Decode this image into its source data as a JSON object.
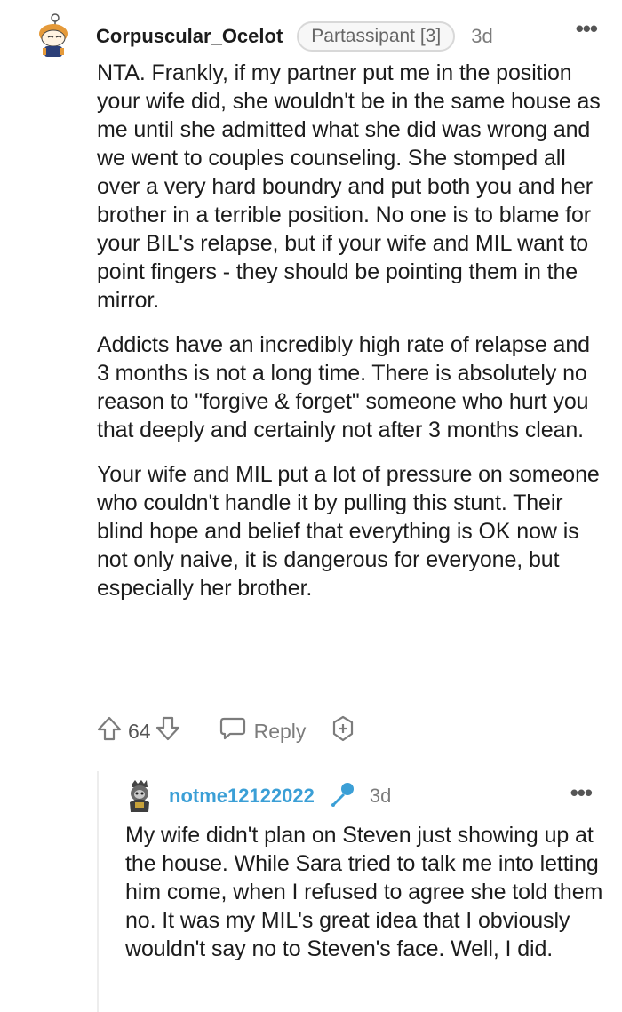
{
  "comment1": {
    "username": "Corpuscular_Ocelot",
    "flair": "Partassipant [3]",
    "age": "3d",
    "more": "•••",
    "paragraphs": [
      "NTA. Frankly, if my partner put me in the position your wife did, she wouldn't be in the same house as me until she admitted what she did was wrong and we went to couples counseling. She stomped all over a very hard boundry and put both you and her brother in a terrible position. No one is to blame for your BIL's relapse, but if your wife and MIL want to point fingers - they should be pointing them in the mirror.",
      "Addicts have an incredibly high rate of relapse and 3 months is not a long time. There is absolutely no reason to \"forgive & forget\" someone who hurt you that deeply and certainly not after 3 months clean.",
      "Your wife and MIL put a lot of pressure on someone who couldn't handle it by pulling this stunt. Their blind hope and belief that everything is OK now is not only naive, it is dangerous for everyone, but especially her brother."
    ],
    "score": "64",
    "reply_label": "Reply"
  },
  "comment2": {
    "username": "notme12122022",
    "age": "3d",
    "more": "•••",
    "paragraphs": [
      "My wife didn't plan on Steven just showing up at the house. While Sara tried to talk me into letting him come, when I refused to agree she told them no. It was my MIL's great idea that I obviously wouldn't say no to Steven's face. Well, I did."
    ]
  },
  "colors": {
    "op_blue": "#3b9fd6",
    "meta_gray": "#7c7c7c",
    "text": "#1c1c1c"
  }
}
